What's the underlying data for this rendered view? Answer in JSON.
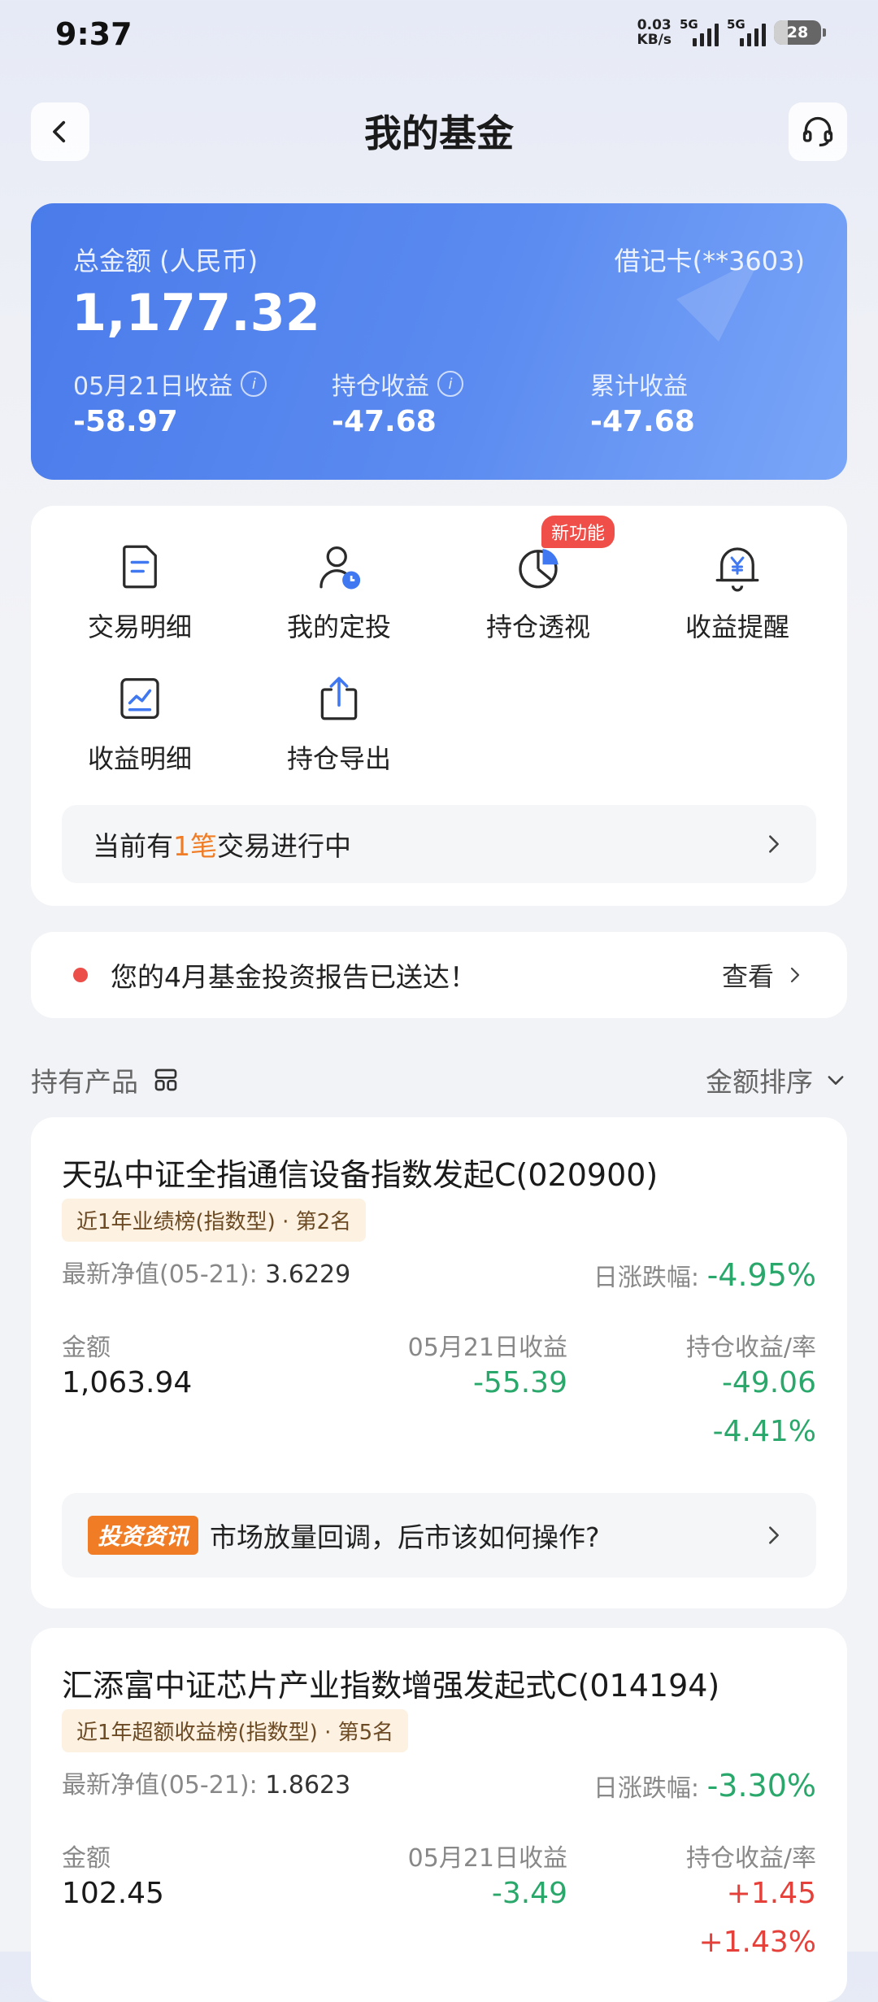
{
  "status_bar": {
    "time": "9:37",
    "net_speed_value": "0.03",
    "net_speed_unit": "KB/s",
    "sim1": "5G",
    "sim2": "5G",
    "battery": "28"
  },
  "header": {
    "title": "我的基金",
    "back_icon": "chevron-left-icon",
    "service_icon": "headset-icon"
  },
  "summary": {
    "total_label": "总金额 (人民币)",
    "card_label": "借记卡(**3603)",
    "total_value": "1,177.32",
    "stats": [
      {
        "label": "05月21日收益",
        "value": "-58.97",
        "info": "i"
      },
      {
        "label": "持仓收益",
        "value": "-47.68",
        "info": "i"
      },
      {
        "label": "累计收益",
        "value": "-47.68"
      }
    ]
  },
  "functions": {
    "items": [
      {
        "label": "交易明细",
        "icon": "document-icon"
      },
      {
        "label": "我的定投",
        "icon": "user-clock-icon"
      },
      {
        "label": "持仓透视",
        "icon": "pie-chart-icon",
        "badge": "新功能"
      },
      {
        "label": "收益提醒",
        "icon": "bell-yen-icon"
      },
      {
        "label": "收益明细",
        "icon": "trend-chart-icon"
      },
      {
        "label": "持仓导出",
        "icon": "export-icon"
      }
    ],
    "pending": {
      "prefix": "当前有",
      "highlight": "1笔",
      "suffix": "交易进行中"
    }
  },
  "report": {
    "text": "您的4月基金投资报告已送达！",
    "action": "查看"
  },
  "holdings": {
    "title": "持有产品",
    "sort_label": "金额排序",
    "funds": [
      {
        "name": "天弘中证全指通信设备指数发起C(020900)",
        "rank": "近1年业绩榜(指数型) · 第2名",
        "nav_label": "最新净值(05-21):",
        "nav_value": "3.6229",
        "change_label": "日涨跌幅:",
        "change_value": "-4.95%",
        "amount_label": "金额",
        "amount_value": "1,063.94",
        "daily_label": "05月21日收益",
        "daily_value": "-55.39",
        "hold_label": "持仓收益/率",
        "hold_value": "-49.06",
        "hold_rate": "-4.41%",
        "news_tag": "投资资讯",
        "news_text": "市场放量回调，后市该如何操作?"
      },
      {
        "name": "汇添富中证芯片产业指数增强发起式C(014194)",
        "rank": "近1年超额收益榜(指数型) · 第5名",
        "nav_label": "最新净值(05-21):",
        "nav_value": "1.8623",
        "change_label": "日涨跌幅:",
        "change_value": "-3.30%",
        "amount_label": "金额",
        "amount_value": "102.45",
        "daily_label": "05月21日收益",
        "daily_value": "-3.49",
        "hold_label": "持仓收益/率",
        "hold_value": "+1.45",
        "hold_rate": "+1.43%"
      }
    ]
  },
  "colors": {
    "accent_blue": "#4a7bea",
    "loss_green": "#2aa86b",
    "gain_red": "#e5413a",
    "highlight_orange": "#f07d26"
  }
}
